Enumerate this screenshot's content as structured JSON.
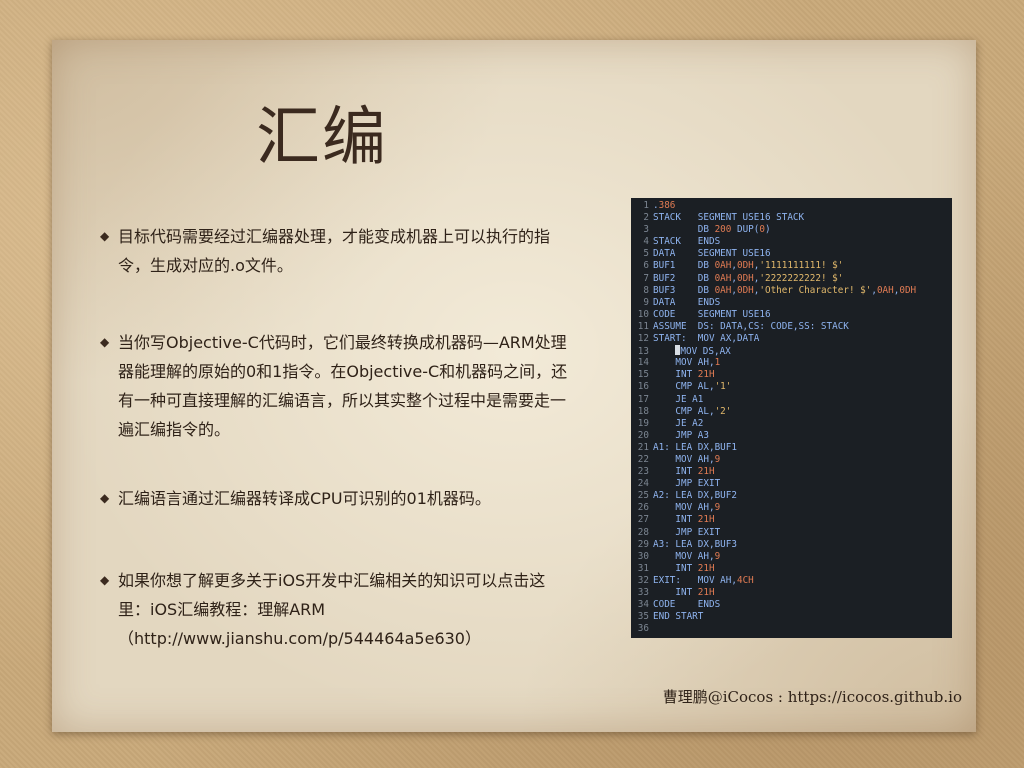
{
  "slide": {
    "title": "汇编",
    "bullets": [
      "目标代码需要经过汇编器处理，才能变成机器上可以执行的指令，生成对应的.o文件。",
      "当你写Objective-C代码时，它们最终转换成机器码—ARM处理器能理解的原始的0和1指令。在Objective-C和机器码之间，还有一种可直接理解的汇编语言，所以其实整个过程中是需要走一遍汇编指令的。",
      "汇编语言通过汇编器转译成CPU可识别的01机器码。",
      "如果你想了解更多关于iOS开发中汇编相关的知识可以点击这里：iOS汇编教程：理解ARM（http://www.jianshu.com/p/544464a5e630）"
    ],
    "footer": "曹理鹏@iCocos : https://icocos.github.io"
  },
  "code": {
    "lines": [
      ".386",
      "STACK   SEGMENT USE16 STACK",
      "        DB 200 DUP(0)",
      "STACK   ENDS",
      "DATA    SEGMENT USE16",
      "BUF1    DB 0AH,0DH,'1111111111! $'",
      "BUF2    DB 0AH,0DH,'2222222222! $'",
      "BUF3    DB 0AH,0DH,'Other Character! $',0AH,0DH",
      "DATA    ENDS",
      "CODE    SEGMENT USE16",
      "ASSUME  DS: DATA,CS: CODE,SS: STACK",
      "START:  MOV AX,DATA",
      "    MOV DS,AX",
      "    MOV AH,1",
      "    INT 21H",
      "    CMP AL,'1'",
      "    JE A1",
      "    CMP AL,'2'",
      "    JE A2",
      "    JMP A3",
      "A1: LEA DX,BUF1",
      "    MOV AH,9",
      "    INT 21H",
      "    JMP EXIT",
      "A2: LEA DX,BUF2",
      "    MOV AH,9",
      "    INT 21H",
      "    JMP EXIT",
      "A3: LEA DX,BUF3",
      "    MOV AH,9",
      "    INT 21H",
      "EXIT:   MOV AH,4CH",
      "    INT 21H",
      "CODE    ENDS",
      "END START",
      ""
    ]
  },
  "colors": {
    "background": "#c9a97a",
    "paper": "#e3d7c0",
    "text": "#2f2218",
    "code_bg": "#1b1f24",
    "code_text": "#8fb4f0",
    "code_number": "#e07b53",
    "code_string": "#e1b86b"
  },
  "icons": {
    "bullet": "bullet-dot"
  }
}
